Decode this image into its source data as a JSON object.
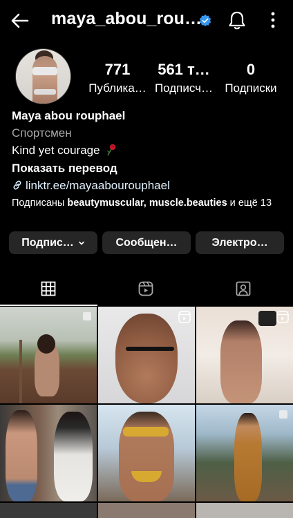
{
  "header": {
    "username": "maya_abou_rou…",
    "icons": [
      "back-arrow-icon",
      "verified-badge-icon",
      "bell-icon",
      "more-vertical-icon"
    ],
    "verified_color": "#3897f0"
  },
  "stats": [
    {
      "value": "771",
      "label": "Публика…"
    },
    {
      "value": "561 т…",
      "label": "Подписч…"
    },
    {
      "value": "0",
      "label": "Подписки"
    }
  ],
  "bio": {
    "name": "Maya abou rouphael",
    "category": "Спортсмен",
    "text": "Kind yet courage",
    "translate": "Показать перевод",
    "link": "linktr.ee/mayaabourouphael",
    "followed_prefix": "Подписаны ",
    "followed_users": "beautymuscular, muscle.beauties",
    "followed_suffix": " и ещё 13"
  },
  "buttons": {
    "follow": "Подпис…",
    "message": "Сообщен…",
    "email": "Электро…"
  },
  "tabs": [
    "grid-icon",
    "reels-icon",
    "tagged-icon"
  ],
  "grid": {
    "cells": [
      {
        "badge": "multi-photo-icon"
      },
      {
        "badge": "reel-icon"
      },
      {
        "badge": "reel-icon"
      },
      {
        "badge": ""
      },
      {
        "badge": ""
      },
      {
        "badge": "multi-photo-icon"
      }
    ]
  },
  "colors": {
    "background": "#000000",
    "button_bg": "#262626",
    "secondary_text": "#a8a8a8",
    "link_text": "#e0f1ff"
  }
}
